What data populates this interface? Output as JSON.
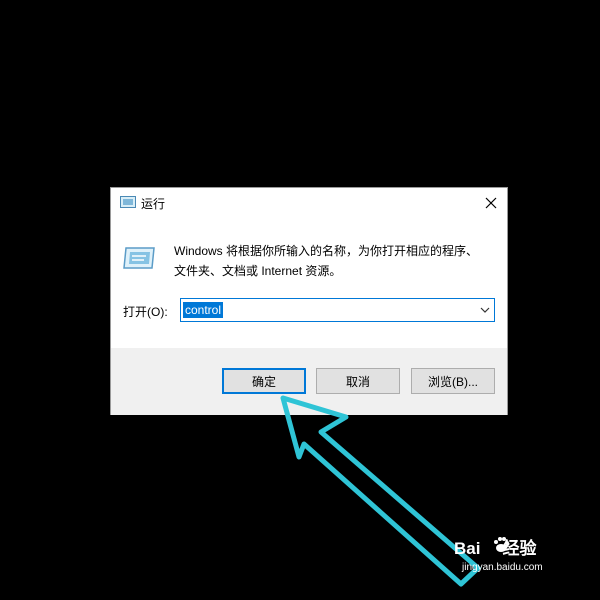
{
  "dialog": {
    "title": "运行",
    "icons": {
      "title": "run-icon",
      "close": "close-icon",
      "body": "run-icon"
    },
    "description_line1": "Windows 将根据你所输入的名称，为你打开相应的程序、",
    "description_line2": "文件夹、文档或 Internet 资源。",
    "open_label": "打开(O):",
    "open_value": "control",
    "buttons": {
      "ok": "确定",
      "cancel": "取消",
      "browse": "浏览(B)..."
    },
    "accent_color": "#0078d7"
  },
  "annotation": {
    "arrow_color": "#2fc4d6"
  },
  "watermark": {
    "brand_left": "Bai",
    "brand_right": "经验",
    "url": "jingyan.baidu.com"
  }
}
